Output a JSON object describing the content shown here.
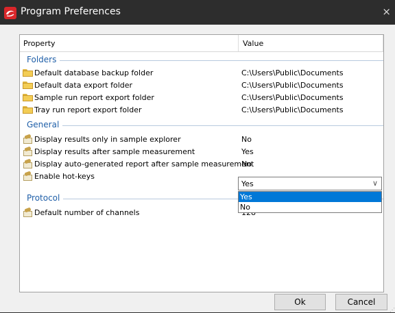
{
  "window": {
    "title": "Program Preferences",
    "close_symbol": "×",
    "accent": "#d9262a"
  },
  "grid": {
    "columns": [
      "Property",
      "Value"
    ],
    "groups": [
      {
        "name": "Folders",
        "rows": [
          {
            "label": "Default database backup folder",
            "value": "C:\\Users\\Public\\Documents",
            "icon": "folder-icon"
          },
          {
            "label": "Default data export folder",
            "value": "C:\\Users\\Public\\Documents",
            "icon": "folder-icon"
          },
          {
            "label": "Sample run report export folder",
            "value": "C:\\Users\\Public\\Documents",
            "icon": "folder-icon"
          },
          {
            "label": "Tray run report export folder",
            "value": "C:\\Users\\Public\\Documents",
            "icon": "folder-icon"
          }
        ]
      },
      {
        "name": "General",
        "rows": [
          {
            "label": "Display results only in sample explorer",
            "value": "No",
            "icon": "setting-icon"
          },
          {
            "label": "Display results after sample measurement",
            "value": "Yes",
            "icon": "setting-icon"
          },
          {
            "label": "Display auto-generated report after sample measurement",
            "value": "No",
            "icon": "setting-icon"
          },
          {
            "label": "Enable hot-keys",
            "value": "Yes",
            "icon": "setting-icon"
          }
        ]
      },
      {
        "name": "Protocol",
        "rows": [
          {
            "label": "Default number of channels",
            "value": "128",
            "icon": "setting-icon"
          }
        ]
      }
    ]
  },
  "dropdown": {
    "selected": "Yes",
    "options": [
      "Yes",
      "No"
    ],
    "highlighted": "Yes",
    "highlight_color": "#0078d7"
  },
  "buttons": {
    "ok": "Ok",
    "cancel": "Cancel"
  }
}
